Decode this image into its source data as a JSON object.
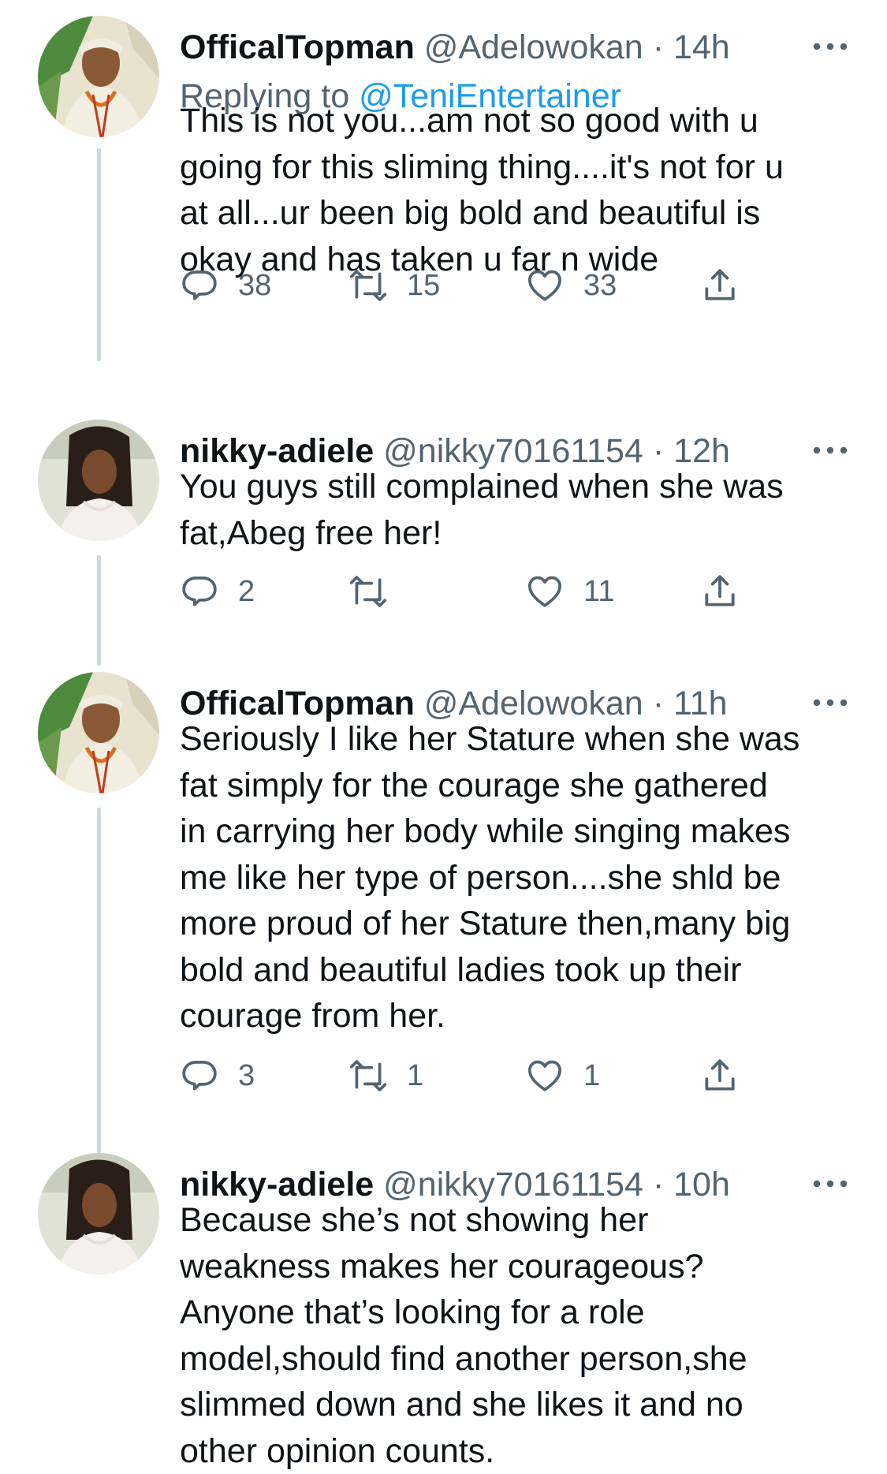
{
  "tweets": [
    {
      "name": "OfficalTopman",
      "handle": "@Adelowokan",
      "time": "· 14h",
      "replying_label": "Replying to ",
      "replying_to": "@TeniEntertainer",
      "lines": [
        "This is not you...am not so good with u",
        "going for this sliming thing....it's not for u",
        "at all...ur been big bold and beautiful is",
        "okay and has taken u far n wide"
      ],
      "replies": "38",
      "retweets": "15",
      "likes": "33",
      "avatar": "man-in-agbada-avatar"
    },
    {
      "name": "nikky-adiele",
      "handle": "@nikky70161154",
      "time": "· 12h",
      "lines": [
        "You guys still complained when she was",
        "fat,Abeg free her!"
      ],
      "replies": "2",
      "retweets": "",
      "likes": "11",
      "avatar": "woman-avatar"
    },
    {
      "name": "OfficalTopman",
      "handle": "@Adelowokan",
      "time": "· 11h",
      "lines": [
        "Seriously I like her Stature when she was",
        "fat simply for the courage she gathered",
        "in carrying her body while singing makes",
        "me like her type of person....she shld be",
        "more proud of her Stature then,many big",
        "bold and beautiful ladies took up their",
        "courage from her."
      ],
      "replies": "3",
      "retweets": "1",
      "likes": "1",
      "avatar": "man-in-agbada-avatar"
    },
    {
      "name": "nikky-adiele",
      "handle": "@nikky70161154",
      "time": "· 10h",
      "lines": [
        "Because she’s not showing her",
        "weakness makes her courageous?",
        "Anyone that’s looking for a role",
        "model,should find another person,she",
        "slimmed down and she likes it and no",
        "other opinion counts."
      ],
      "avatar": "woman-avatar"
    }
  ],
  "colors": {
    "text": "#0f1419",
    "secondary": "#536471",
    "link": "#1d9bf0",
    "thread_line": "#cfd9de"
  },
  "icons": {
    "reply": "reply-icon",
    "retweet": "retweet-icon",
    "like": "heart-icon",
    "share": "share-icon",
    "more": "more-options-icon"
  }
}
